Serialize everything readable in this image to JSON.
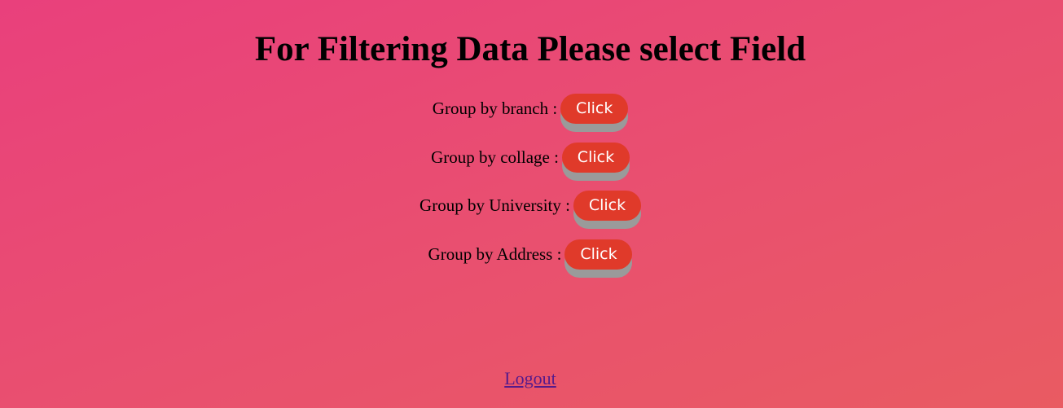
{
  "page": {
    "title": "For Filtering Data Please select Field"
  },
  "filters": [
    {
      "label": "Group by branch :",
      "button": "Click"
    },
    {
      "label": "Group by collage :",
      "button": "Click"
    },
    {
      "label": "Group by University :",
      "button": "Click"
    },
    {
      "label": "Group by Address :",
      "button": "Click"
    }
  ],
  "footer": {
    "logout_label": "Logout"
  },
  "colors": {
    "background_start": "#e9407c",
    "background_end": "#e95b62",
    "button": "#e03a2a",
    "button_shadow": "#9a9a9a",
    "link_visited": "#551a8b"
  }
}
